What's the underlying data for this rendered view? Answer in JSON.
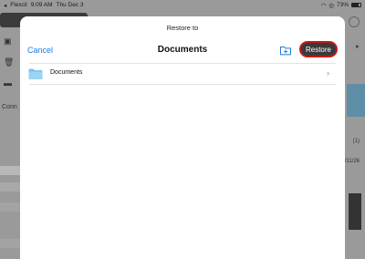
{
  "status_bar": {
    "app": "Flexcil",
    "time": "9:09 AM",
    "date": "Thu Dec 3",
    "battery": "73%",
    "battery_level": 0.73
  },
  "background": {
    "connect_label": "Conn",
    "right_snippet_1": "(1)",
    "right_snippet_2": "0/11/26"
  },
  "sheet": {
    "title": "Restore to",
    "nav": {
      "cancel_label": "Cancel",
      "title": "Documents",
      "restore_label": "Restore"
    },
    "folders": [
      {
        "label": "Documents"
      }
    ]
  },
  "colors": {
    "accent": "#1c7fe0",
    "restore_bg": "#3a3a3a",
    "highlight_ring": "#c81818",
    "folder": "#7cc0ea"
  }
}
